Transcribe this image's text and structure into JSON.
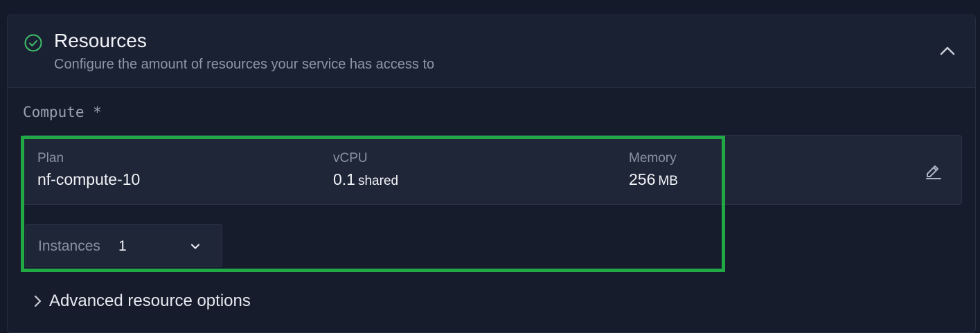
{
  "section": {
    "title": "Resources",
    "subtitle": "Configure the amount of resources your service has access to"
  },
  "compute": {
    "label": "Compute *",
    "plan_label": "Plan",
    "plan_value": "nf-compute-10",
    "vcpu_label": "vCPU",
    "vcpu_value": "0.1",
    "vcpu_unit": "shared",
    "memory_label": "Memory",
    "memory_value": "256",
    "memory_unit": "MB"
  },
  "instances": {
    "label": "Instances",
    "value": "1"
  },
  "advanced": {
    "label": "Advanced resource options"
  },
  "icons": {
    "status": "check-circle-icon",
    "collapse": "chevron-up-icon",
    "edit": "pencil-icon",
    "dropdown": "chevron-down-icon",
    "expand": "chevron-right-icon"
  },
  "colors": {
    "accent_green": "#21a945",
    "status_green": "#3fbf6a"
  }
}
